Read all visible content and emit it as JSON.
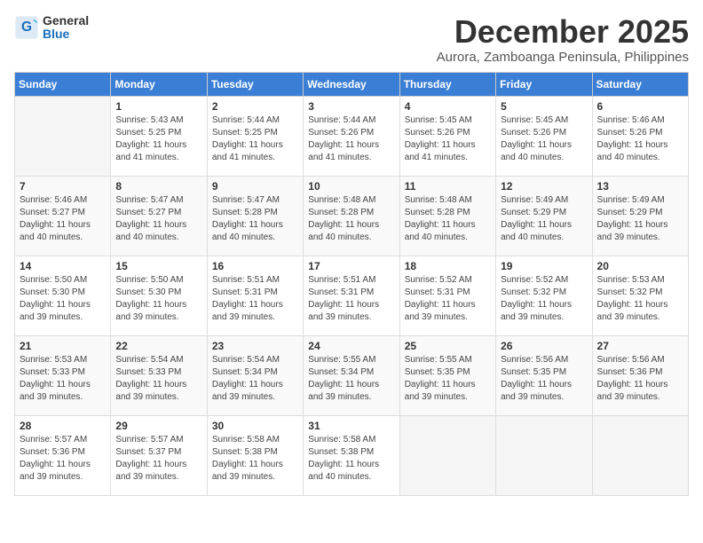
{
  "logo": {
    "general": "General",
    "blue": "Blue"
  },
  "title": "December 2025",
  "subtitle": "Aurora, Zamboanga Peninsula, Philippines",
  "header": {
    "days": [
      "Sunday",
      "Monday",
      "Tuesday",
      "Wednesday",
      "Thursday",
      "Friday",
      "Saturday"
    ]
  },
  "weeks": [
    [
      {
        "day": "",
        "sunrise": "",
        "sunset": "",
        "daylight": ""
      },
      {
        "day": "1",
        "sunrise": "Sunrise: 5:43 AM",
        "sunset": "Sunset: 5:25 PM",
        "daylight": "Daylight: 11 hours and 41 minutes."
      },
      {
        "day": "2",
        "sunrise": "Sunrise: 5:44 AM",
        "sunset": "Sunset: 5:25 PM",
        "daylight": "Daylight: 11 hours and 41 minutes."
      },
      {
        "day": "3",
        "sunrise": "Sunrise: 5:44 AM",
        "sunset": "Sunset: 5:26 PM",
        "daylight": "Daylight: 11 hours and 41 minutes."
      },
      {
        "day": "4",
        "sunrise": "Sunrise: 5:45 AM",
        "sunset": "Sunset: 5:26 PM",
        "daylight": "Daylight: 11 hours and 41 minutes."
      },
      {
        "day": "5",
        "sunrise": "Sunrise: 5:45 AM",
        "sunset": "Sunset: 5:26 PM",
        "daylight": "Daylight: 11 hours and 40 minutes."
      },
      {
        "day": "6",
        "sunrise": "Sunrise: 5:46 AM",
        "sunset": "Sunset: 5:26 PM",
        "daylight": "Daylight: 11 hours and 40 minutes."
      }
    ],
    [
      {
        "day": "7",
        "sunrise": "Sunrise: 5:46 AM",
        "sunset": "Sunset: 5:27 PM",
        "daylight": "Daylight: 11 hours and 40 minutes."
      },
      {
        "day": "8",
        "sunrise": "Sunrise: 5:47 AM",
        "sunset": "Sunset: 5:27 PM",
        "daylight": "Daylight: 11 hours and 40 minutes."
      },
      {
        "day": "9",
        "sunrise": "Sunrise: 5:47 AM",
        "sunset": "Sunset: 5:28 PM",
        "daylight": "Daylight: 11 hours and 40 minutes."
      },
      {
        "day": "10",
        "sunrise": "Sunrise: 5:48 AM",
        "sunset": "Sunset: 5:28 PM",
        "daylight": "Daylight: 11 hours and 40 minutes."
      },
      {
        "day": "11",
        "sunrise": "Sunrise: 5:48 AM",
        "sunset": "Sunset: 5:28 PM",
        "daylight": "Daylight: 11 hours and 40 minutes."
      },
      {
        "day": "12",
        "sunrise": "Sunrise: 5:49 AM",
        "sunset": "Sunset: 5:29 PM",
        "daylight": "Daylight: 11 hours and 40 minutes."
      },
      {
        "day": "13",
        "sunrise": "Sunrise: 5:49 AM",
        "sunset": "Sunset: 5:29 PM",
        "daylight": "Daylight: 11 hours and 39 minutes."
      }
    ],
    [
      {
        "day": "14",
        "sunrise": "Sunrise: 5:50 AM",
        "sunset": "Sunset: 5:30 PM",
        "daylight": "Daylight: 11 hours and 39 minutes."
      },
      {
        "day": "15",
        "sunrise": "Sunrise: 5:50 AM",
        "sunset": "Sunset: 5:30 PM",
        "daylight": "Daylight: 11 hours and 39 minutes."
      },
      {
        "day": "16",
        "sunrise": "Sunrise: 5:51 AM",
        "sunset": "Sunset: 5:31 PM",
        "daylight": "Daylight: 11 hours and 39 minutes."
      },
      {
        "day": "17",
        "sunrise": "Sunrise: 5:51 AM",
        "sunset": "Sunset: 5:31 PM",
        "daylight": "Daylight: 11 hours and 39 minutes."
      },
      {
        "day": "18",
        "sunrise": "Sunrise: 5:52 AM",
        "sunset": "Sunset: 5:31 PM",
        "daylight": "Daylight: 11 hours and 39 minutes."
      },
      {
        "day": "19",
        "sunrise": "Sunrise: 5:52 AM",
        "sunset": "Sunset: 5:32 PM",
        "daylight": "Daylight: 11 hours and 39 minutes."
      },
      {
        "day": "20",
        "sunrise": "Sunrise: 5:53 AM",
        "sunset": "Sunset: 5:32 PM",
        "daylight": "Daylight: 11 hours and 39 minutes."
      }
    ],
    [
      {
        "day": "21",
        "sunrise": "Sunrise: 5:53 AM",
        "sunset": "Sunset: 5:33 PM",
        "daylight": "Daylight: 11 hours and 39 minutes."
      },
      {
        "day": "22",
        "sunrise": "Sunrise: 5:54 AM",
        "sunset": "Sunset: 5:33 PM",
        "daylight": "Daylight: 11 hours and 39 minutes."
      },
      {
        "day": "23",
        "sunrise": "Sunrise: 5:54 AM",
        "sunset": "Sunset: 5:34 PM",
        "daylight": "Daylight: 11 hours and 39 minutes."
      },
      {
        "day": "24",
        "sunrise": "Sunrise: 5:55 AM",
        "sunset": "Sunset: 5:34 PM",
        "daylight": "Daylight: 11 hours and 39 minutes."
      },
      {
        "day": "25",
        "sunrise": "Sunrise: 5:55 AM",
        "sunset": "Sunset: 5:35 PM",
        "daylight": "Daylight: 11 hours and 39 minutes."
      },
      {
        "day": "26",
        "sunrise": "Sunrise: 5:56 AM",
        "sunset": "Sunset: 5:35 PM",
        "daylight": "Daylight: 11 hours and 39 minutes."
      },
      {
        "day": "27",
        "sunrise": "Sunrise: 5:56 AM",
        "sunset": "Sunset: 5:36 PM",
        "daylight": "Daylight: 11 hours and 39 minutes."
      }
    ],
    [
      {
        "day": "28",
        "sunrise": "Sunrise: 5:57 AM",
        "sunset": "Sunset: 5:36 PM",
        "daylight": "Daylight: 11 hours and 39 minutes."
      },
      {
        "day": "29",
        "sunrise": "Sunrise: 5:57 AM",
        "sunset": "Sunset: 5:37 PM",
        "daylight": "Daylight: 11 hours and 39 minutes."
      },
      {
        "day": "30",
        "sunrise": "Sunrise: 5:58 AM",
        "sunset": "Sunset: 5:38 PM",
        "daylight": "Daylight: 11 hours and 39 minutes."
      },
      {
        "day": "31",
        "sunrise": "Sunrise: 5:58 AM",
        "sunset": "Sunset: 5:38 PM",
        "daylight": "Daylight: 11 hours and 40 minutes."
      },
      {
        "day": "",
        "sunrise": "",
        "sunset": "",
        "daylight": ""
      },
      {
        "day": "",
        "sunrise": "",
        "sunset": "",
        "daylight": ""
      },
      {
        "day": "",
        "sunrise": "",
        "sunset": "",
        "daylight": ""
      }
    ]
  ]
}
